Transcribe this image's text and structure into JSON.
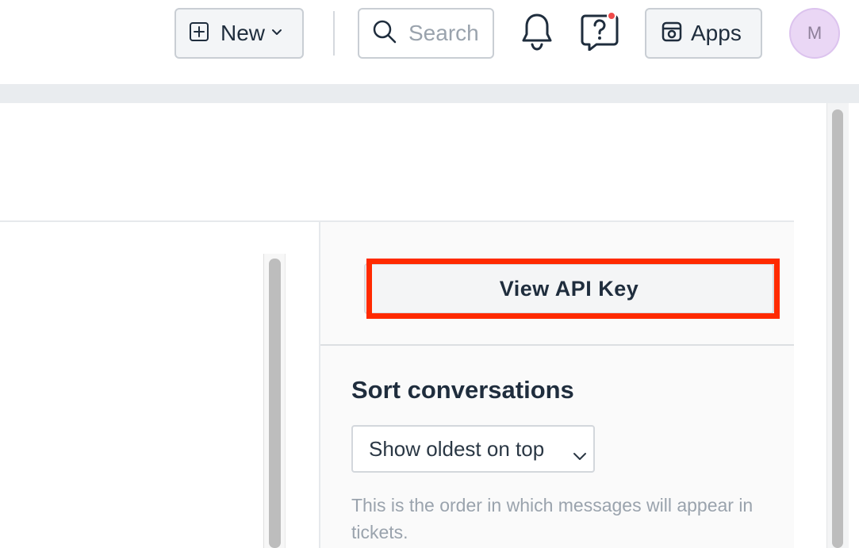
{
  "header": {
    "new_label": "New",
    "search_placeholder": "Search",
    "apps_label": "Apps",
    "avatar_initial": "M",
    "icons": [
      "plus-square-icon",
      "chevron-down-icon",
      "search-icon",
      "bell-icon",
      "help-icon",
      "apps-icon"
    ],
    "notification_dot_color": "#f04a4a"
  },
  "settings_panel": {
    "api_key_button": "View API Key",
    "sort_title": "Sort conversations",
    "sort_selected": "Show oldest on top",
    "sort_help": "This is the order in which messages will appear in tickets."
  },
  "colors": {
    "highlight_box": "#ff2a00",
    "avatar_bg": "#ead7f5"
  }
}
